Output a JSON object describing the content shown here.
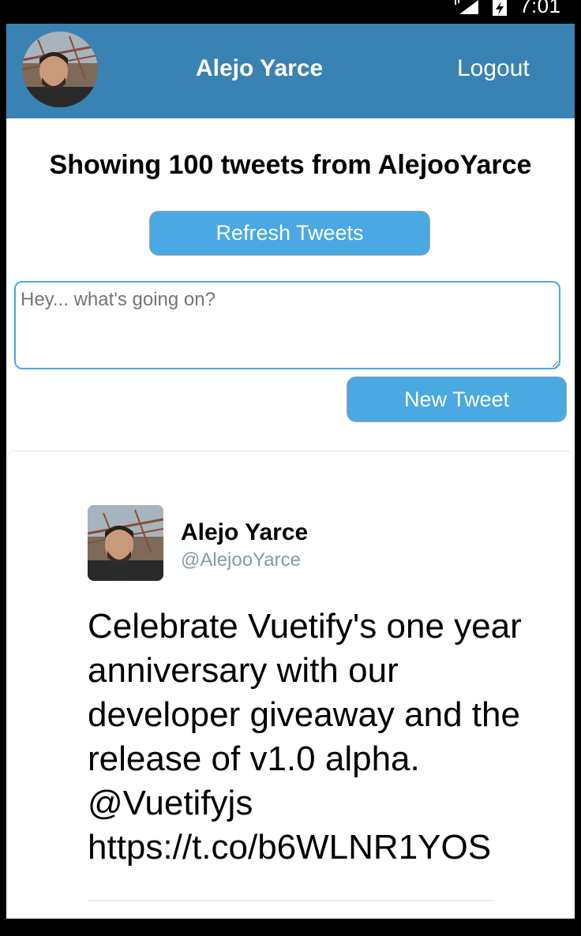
{
  "status_bar": {
    "time": "7:01",
    "icons": [
      "signal-icon",
      "battery-charging-icon"
    ]
  },
  "header": {
    "user_name": "Alejo Yarce",
    "logout_label": "Logout",
    "color": "#3883b3"
  },
  "main": {
    "title": "Showing 100 tweets from AlejooYarce",
    "refresh_label": "Refresh Tweets",
    "input": {
      "value": "",
      "placeholder": "Hey... what's going on?"
    },
    "new_tweet_label": "New Tweet",
    "button_color": "#4aa8e3"
  },
  "tweets": [
    {
      "name": "Alejo Yarce",
      "handle": "@AlejooYarce",
      "text": "Celebrate Vuetify's one year anniversary with our developer giveaway and the release of v1.0 alpha. @Vuetifyjs https://t.co/b6WLNR1YOS"
    }
  ]
}
